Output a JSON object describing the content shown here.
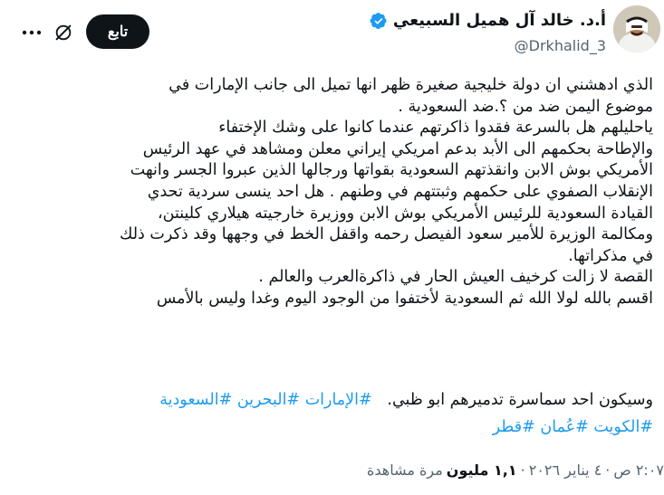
{
  "author": {
    "display_name": "أ.د. خالد آل هميل السبيعي",
    "handle": "@Drkhalid_3",
    "verified_icon": "verified-badge-icon",
    "verified_color": "#1d9bf0"
  },
  "actions": {
    "follow_label": "تابع",
    "grok_icon": "grok-icon",
    "more_icon": "more-dots-icon"
  },
  "tweet": {
    "lines": [
      "الذي ادهشني ان دولة خليجية صغيرة ظهر انها تميل الى جانب الإمارات في",
      "موضوع اليمن ضد من ؟.ضد السعودية .",
      "ياحليلهم هل بالسرعة فقدوا ذاكرتهم عندما كانوا على وشك الإختفاء",
      "والإطاحة بحكمهم الى الأبد بدعم امريكي إيراني معلن ومشاهد في عهد الرئيس",
      "الأمريكي بوش الابن وانقذتهم السعودية بقواتها ورجالها الذين  عبروا الجسر وانهت",
      "الإنقلاب الصفوي على حكمهم وثبتتهم في وطنهم . هل احد ينسى سردية تحدي",
      "القيادة السعودية للرئيس الأمريكي بوش الابن ووزيرة خارجيته هيلاري كلينتن،",
      "ومكالمة الوزيرة للأمير سعود الفيصل رحمه واقفل الخط في وجهها وقد ذكرت ذلك",
      "في مذكراتها.",
      "القصة لا زالت كرخيف العيش الحار في ذاكرةالعرب والعالم .",
      "اقسم بالله لولا الله ثم السعودية لأختفوا من الوجود اليوم وغدا وليس بالأمس"
    ],
    "last_line_prefix": "وسيكون احد سماسرة تدميرهم ابو ظبي.",
    "hashtags_row1": [
      "#الإمارات",
      "#البحرين",
      "#السعودية"
    ],
    "hashtags_row2": [
      "#الكويت",
      "#عُمان",
      "#قطر"
    ]
  },
  "meta": {
    "time": "٢:٠٧ ص",
    "separator": "·",
    "date": "٤ يناير ٢٠٢٦",
    "views_count": "١,١ مليون",
    "views_label": "مرة مشاهدة"
  },
  "colors": {
    "text": "#0f1419",
    "secondary": "#536471",
    "link": "#1d9bf0",
    "button_bg": "#0f1419"
  }
}
